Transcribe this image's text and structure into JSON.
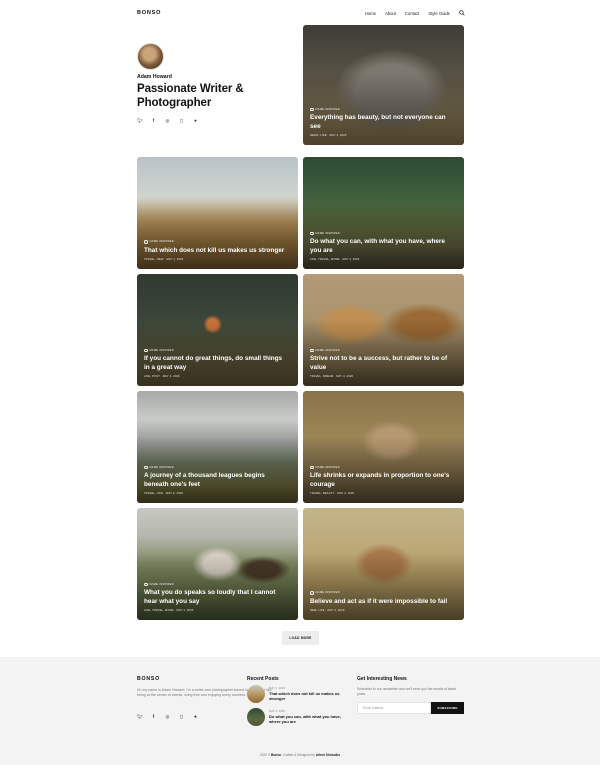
{
  "site": {
    "logo": "BONSO"
  },
  "nav": {
    "items": [
      "Home",
      "About",
      "Contact",
      "Style Guide"
    ]
  },
  "author": {
    "name": "Adam Howard",
    "title": "Passionate Writer & Photographer"
  },
  "posts": [
    {
      "title": "Everything has beauty, but not everyone can see",
      "category": "NAME INSPIRED",
      "info": "NEWS, LIFE  ·  MAY 4, 2020"
    },
    {
      "title": "That which does not kill us makes us stronger",
      "category": "NAME INSPIRED",
      "info": "TRAVEL, NEW  ·  MAY 4, 2020"
    },
    {
      "title": "Do what you can, with what you have, where you are",
      "category": "NAME INSPIRED",
      "info": "LIFE, TRAVEL, MORE  ·  MAY 4, 2020"
    },
    {
      "title": "If you cannot do great things, do small things in a great way",
      "category": "NAME INSPIRED",
      "info": "LIFE, POST  ·  MAY 4, 2020"
    },
    {
      "title": "Strive not to be a success, but rather to be of value",
      "category": "NAME INSPIRED",
      "info": "TRAVEL, DREAM  ·  MAY 4, 2020"
    },
    {
      "title": "A journey of a thousand leagues begins beneath one's feet",
      "category": "NAME INSPIRED",
      "info": "TRAVEL, LIFE  ·  MAY 4, 2020"
    },
    {
      "title": "Life shrinks or expands in proportion to one's courage",
      "category": "NAME INSPIRED",
      "info": "TRAVEL, BEAUTY  ·  MAY 4, 2020"
    },
    {
      "title": "What you do speaks so loudly that I cannot hear what you say",
      "category": "NAME INSPIRED",
      "info": "LIFE, TRAVEL, MORE  ·  MAY 4, 2020"
    },
    {
      "title": "Believe and act as if it were impossible to fail",
      "category": "NAME INSPIRED",
      "info": "NEW, LIFE  ·  MAY 4, 2020"
    }
  ],
  "load_more": "LOAD MORE",
  "footer": {
    "logo": "BONSO",
    "about": "Hi, my name is Adam Howard. I'm a writer and photographer based in Portland. I like being at the center of events, living free and enjoying every moment.",
    "recent_heading": "Recent Posts",
    "recent": [
      {
        "date": "MAY 4, 2020",
        "title": "That which does not kill us makes us stronger"
      },
      {
        "date": "MAY 4, 2020",
        "title": "Do what you can, with what you have, where you are"
      }
    ],
    "news_heading": "Get Interesting News",
    "news_text": "Subscribe to our newsletter and we'll send you the emails of latest posts.",
    "email_placeholder": "Email Address",
    "subscribe_label": "SUBSCRIBE",
    "copyright_prefix": "2020 © ",
    "copyright_brand": "Bonso",
    "copyright_mid": ". Crafted & Designed by ",
    "copyright_author": "Artem Sheludko"
  },
  "colors": {
    "accent": "#111111",
    "footer_bg": "#f3f3f3"
  }
}
